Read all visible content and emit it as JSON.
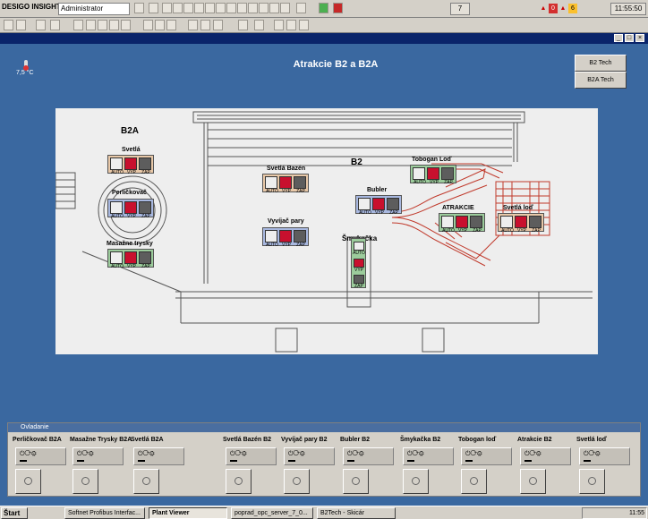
{
  "app": {
    "logo": "DESIGO INSIGHT",
    "user": "Administrator",
    "counter": "7",
    "alarm_a": "0",
    "alarm_b": "6",
    "clock": "11:55:50"
  },
  "screen": {
    "title": "Atrakcie B2 a B2A",
    "temperature": "7,5 °C",
    "nav": [
      "B2 Tech",
      "B2A Tech"
    ]
  },
  "plant": {
    "area_b2a": "B2A",
    "area_b2": "B2",
    "labels": {
      "svetla": "Svetlá",
      "perlickovac": "Perličkovač",
      "masazne": "Masažne trysky",
      "svetla_bazen": "Svetlá Bazén",
      "vyvijac": "Vyvíjač pary",
      "bubler": "Bubler",
      "tobogan": "Tobogan Loď",
      "atrakcie": "ATRAKCIE",
      "svetla_lod": "Svetlá loď",
      "smykacka": "Šmykačka"
    },
    "btn": {
      "auto": "AUTO",
      "vyp": "VYP",
      "zap": "ZAP"
    },
    "colors": {
      "auto_bg": "#eeeeee",
      "vyp": "#c8102e",
      "zap": "#5d5d5d",
      "orange_group": "#e8c8a8",
      "blue_group": "#a8b8e0",
      "green_group": "#9ccc9c"
    }
  },
  "panel": {
    "title": "Ovladanie",
    "cards": [
      "Perličkovač B2A",
      "Masažne Trysky B2A",
      "Svetlá B2A",
      "Svetlá Bazén B2",
      "Vyvíjač pary B2",
      "Bubler B2",
      "Šmykačka B2",
      "Tobogan loď",
      "Atrakcie B2",
      "Svetlá loď"
    ]
  },
  "taskbar": {
    "start": "Štart",
    "tasks": [
      "Softnet Profibus Interfac...",
      "Plant Viewer",
      "poprad_opc_server_7_0...",
      "B2Tech - Skicár"
    ],
    "clock": "11:55"
  }
}
